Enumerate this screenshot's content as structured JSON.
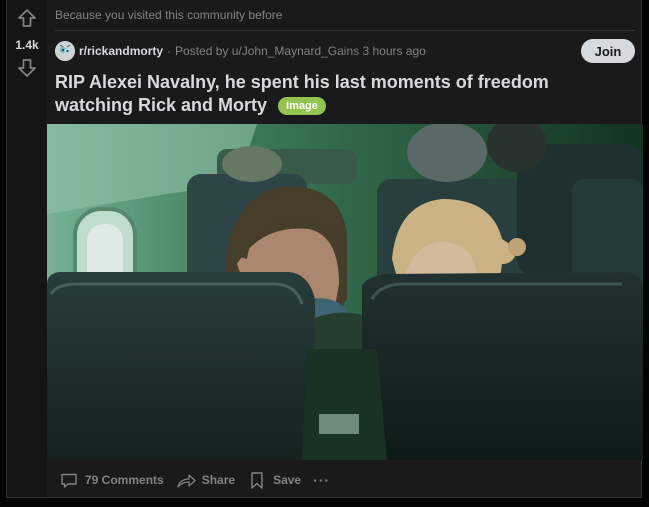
{
  "post": {
    "vote_score": "1.4k",
    "visited_note": "Because you visited this community before",
    "subreddit": "r/rickandmorty",
    "posted_by": "Posted by u/John_Maynard_Gains 3 hours ago",
    "separator": "·",
    "join_label": "Join",
    "title": "RIP Alexei Navalny, he spent his last moments of freedom watching Rick and Morty",
    "flair": "Image",
    "media_alt": "Two passengers seated in an airplane cabin watching a screen"
  },
  "actions": {
    "comments": "79 Comments",
    "share": "Share",
    "save": "Save",
    "more": "···"
  },
  "colors": {
    "background": "#030303",
    "card": "#1a1a1b",
    "text": "#d7dadc",
    "muted": "#818384",
    "flair": "#94c34f",
    "join_button": "#d7dadc"
  },
  "icons": [
    "upvote-icon",
    "downvote-icon",
    "subreddit-icon",
    "comment-icon",
    "share-icon",
    "save-icon",
    "more-icon"
  ]
}
